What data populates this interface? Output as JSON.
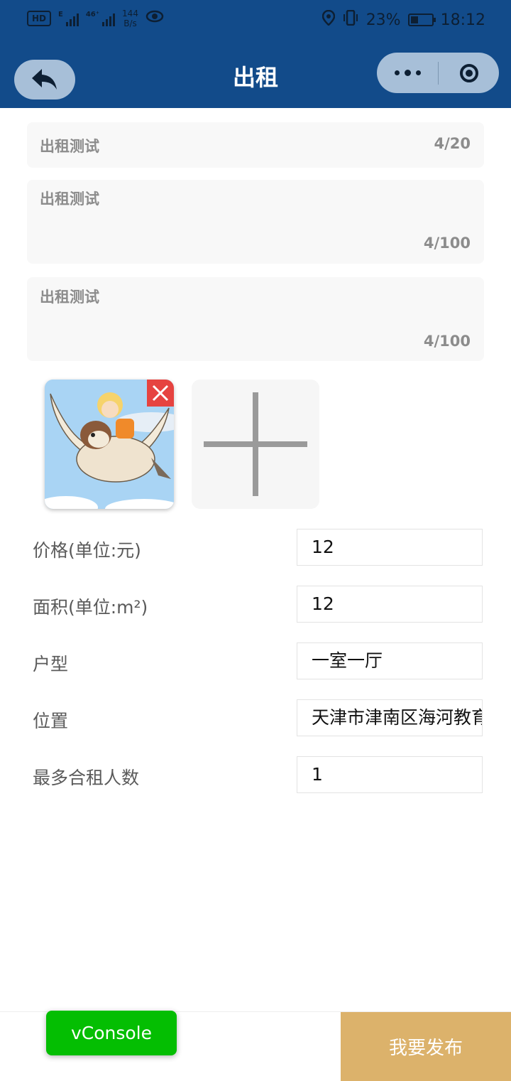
{
  "status_bar": {
    "hd_label": "HD",
    "net_type_1": "E",
    "net_type_2": "46⁺",
    "speed_value": "144",
    "speed_unit": "B/s",
    "battery": "23%",
    "time": "18:12"
  },
  "nav": {
    "title": "出租"
  },
  "form": {
    "title_input": {
      "value": "出租测试",
      "count": "4/20"
    },
    "desc_input_1": {
      "value": "出租测试",
      "count": "4/100"
    },
    "desc_input_2": {
      "value": "出租测试",
      "count": "4/100"
    },
    "fields": [
      {
        "label": "价格(单位:元)",
        "value": "12"
      },
      {
        "label": "面积(单位:m²)",
        "value": "12"
      },
      {
        "label": "户型",
        "value": "一室一厅"
      },
      {
        "label": "位置",
        "value": "天津市津南区海河教育园区"
      },
      {
        "label": "最多合租人数",
        "value": "1"
      }
    ]
  },
  "bottom": {
    "publish_label": "我要发布",
    "vconsole_label": "vConsole"
  },
  "colors": {
    "header": "#124b8a",
    "publish": "#dcb26b",
    "vconsole": "#04be02",
    "delete": "#e64340"
  }
}
